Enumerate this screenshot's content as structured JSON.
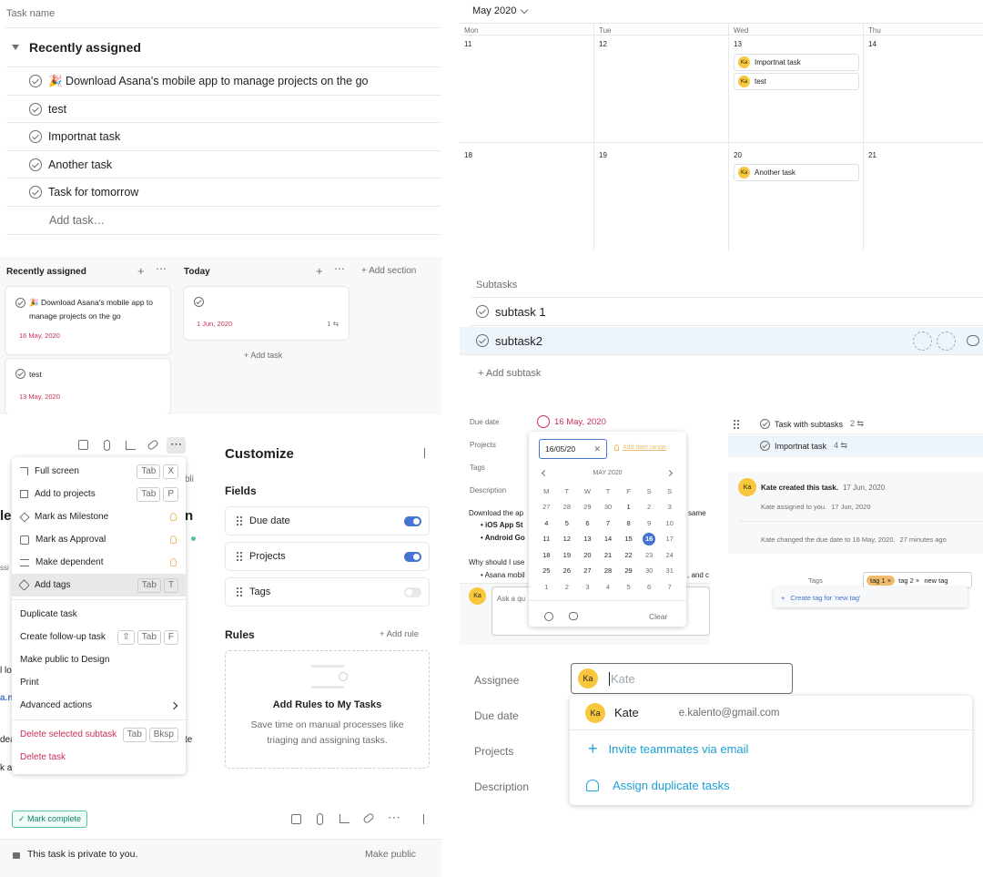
{
  "list": {
    "column_header": "Task name",
    "section_title": "Recently assigned",
    "tasks": [
      "🎉 Download Asana's mobile app to manage projects on the go",
      "test",
      "Importnat task",
      "Another task",
      "Task for tomorrow"
    ],
    "add_task": "Add task…"
  },
  "calendar": {
    "month": "May 2020",
    "days": [
      "Mon",
      "Tue",
      "Wed",
      "Thu"
    ],
    "week1": [
      "11",
      "12",
      "13",
      "14"
    ],
    "week2": [
      "18",
      "19",
      "20",
      "21"
    ],
    "avatar": "Ka",
    "events": {
      "e1": "Importnat task",
      "e2": "test",
      "e3": "Another task"
    }
  },
  "board": {
    "col1_title": "Recently assigned",
    "col2_title": "Today",
    "add_section": "+ Add section",
    "card1": "🎉 Download Asana's mobile app to manage projects on the go",
    "card1_date": "16 May, 2020",
    "card2": "test",
    "card2_date": "13 May, 2020",
    "card3_date": "1 Jun, 2020",
    "card3_subtasks": "1",
    "add_task": "+ Add task"
  },
  "subtasks": {
    "header": "Subtasks",
    "items": [
      "subtask 1",
      "subtask2"
    ],
    "add": "+ Add subtask"
  },
  "menu": {
    "items": [
      {
        "label": "Full screen",
        "keys": [
          "Tab",
          "X"
        ]
      },
      {
        "label": "Add to projects",
        "keys": [
          "Tab",
          "P"
        ]
      },
      {
        "label": "Mark as Milestone"
      },
      {
        "label": "Mark as Approval"
      },
      {
        "label": "Make dependent"
      },
      {
        "label": "Add tags",
        "keys": [
          "Tab",
          "T"
        ]
      }
    ],
    "items2": [
      "Duplicate task",
      "Create follow-up task",
      "Make public to Design",
      "Print",
      "Advanced actions"
    ],
    "followup_keys": [
      "⇧",
      "Tab",
      "F"
    ],
    "delete_subtask": "Delete selected subtask",
    "delete_subtask_keys": [
      "Tab",
      "Bksp"
    ],
    "delete_task": "Delete task",
    "bg_fragments": [
      "bli",
      "le",
      "n",
      "ssi",
      "l lo",
      "a.n",
      "dea",
      "k a",
      "te"
    ]
  },
  "customize": {
    "title": "Customize",
    "fields_header": "Fields",
    "fields": [
      {
        "label": "Due date",
        "on": true
      },
      {
        "label": "Projects",
        "on": true
      },
      {
        "label": "Tags",
        "on": false
      }
    ],
    "rules_header": "Rules",
    "add_rule": "+ Add rule",
    "rules_title": "Add Rules to My Tasks",
    "rules_desc": "Save time on manual processes like triaging and assigning tasks."
  },
  "detail": {
    "labels": [
      "Due date",
      "Projects",
      "Tags",
      "Description"
    ],
    "due_value": "16 May, 2020",
    "desc_line1": "Download the ap",
    "desc_line1_end": "same",
    "bullet1": "iOS App St",
    "bullet2": "Android Go",
    "desc_line2": "Why should I use",
    "bullet3": "Asana mobil",
    "bullet3_end": ", and c",
    "ask": "Ask a qu"
  },
  "datepicker": {
    "input": "16/05/20",
    "add_range": "Add date range",
    "month": "MAY 2020",
    "weekdays": [
      "M",
      "T",
      "W",
      "T",
      "F",
      "S",
      "S"
    ],
    "weeks": [
      [
        "27",
        "28",
        "29",
        "30",
        "1",
        "2",
        "3"
      ],
      [
        "4",
        "5",
        "6",
        "7",
        "8",
        "9",
        "10"
      ],
      [
        "11",
        "12",
        "13",
        "14",
        "15",
        "16",
        "17"
      ],
      [
        "18",
        "19",
        "20",
        "21",
        "22",
        "23",
        "24"
      ],
      [
        "25",
        "26",
        "27",
        "28",
        "29",
        "30",
        "31"
      ],
      [
        "1",
        "2",
        "3",
        "4",
        "5",
        "6",
        "7"
      ]
    ],
    "selected": "16",
    "clear": "Clear"
  },
  "activity": {
    "parent1": "Task with subtasks",
    "parent1_count": "2",
    "parent2": "Importnat task",
    "parent2_count": "4",
    "creator": "Kate created this task.",
    "created_date": "17 Jun, 2020",
    "assigned": "Kate assigned to you.",
    "assigned_date": "17 Jun, 2020",
    "changed": "Kate changed the due date to 16 May, 2020.",
    "changed_time": "27 minutes ago"
  },
  "tags": {
    "label": "Tags",
    "tag1": "tag 1",
    "tag2": "tag 2",
    "input": "new tag",
    "create": "Create tag for 'new tag'"
  },
  "footer": {
    "mark_complete": "✓ Mark complete",
    "private": "This task is private to you.",
    "make_public": "Make public"
  },
  "assignee": {
    "labels": [
      "Assignee",
      "Due date",
      "Projects",
      "Description"
    ],
    "placeholder": "Kate",
    "avatar": "Ka",
    "option_name": "Kate",
    "option_email": "e.kalento@gmail.com",
    "invite": "Invite teammates via email",
    "assign_dup": "Assign duplicate tasks"
  }
}
